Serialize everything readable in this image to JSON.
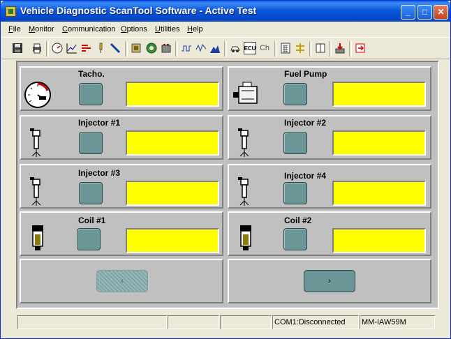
{
  "window": {
    "title": "Vehicle Diagnostic ScanTool Software - Active Test",
    "controls": {
      "minimize": "_",
      "maximize": "□",
      "close": "✕"
    }
  },
  "menu": [
    {
      "label": "File",
      "mnemonic": "F"
    },
    {
      "label": "Monitor",
      "mnemonic": "M"
    },
    {
      "label": "Communication",
      "mnemonic": "C"
    },
    {
      "label": "Options",
      "mnemonic": "O"
    },
    {
      "label": "Utilities",
      "mnemonic": "U"
    },
    {
      "label": "Help",
      "mnemonic": "H"
    }
  ],
  "toolbar": {
    "icons": [
      "save-icon",
      "print-icon",
      "gauge-icon",
      "line-graph-icon",
      "bar-graph-icon",
      "probe-icon",
      "wand-icon",
      "chip-icon",
      "gear-icon",
      "battery-icon",
      "waveform-icon",
      "scope-icon",
      "mountain-graph-icon",
      "car-icon",
      "ecu-icon",
      "channel-icon",
      "calculator-icon",
      "wiring-icon",
      "book-icon",
      "download-icon",
      "exit-icon"
    ],
    "ecu_label": "ECU",
    "ch_label": "Ch"
  },
  "tests": [
    {
      "title": "Tacho.",
      "icon": "tachometer-icon",
      "value": ""
    },
    {
      "title": "Fuel Pump",
      "icon": "fuel-pump-icon",
      "value": ""
    },
    {
      "title": "Injector #1",
      "icon": "injector-icon",
      "value": ""
    },
    {
      "title": "Injector #2",
      "icon": "injector-icon",
      "value": ""
    },
    {
      "title": "Injector #3",
      "icon": "injector-icon",
      "value": ""
    },
    {
      "title": "Injector #4",
      "icon": "injector-icon",
      "value": ""
    },
    {
      "title": "Coil #1",
      "icon": "ignition-coil-icon",
      "value": ""
    },
    {
      "title": "Coil #2",
      "icon": "ignition-coil-icon",
      "value": ""
    }
  ],
  "nav": {
    "prev_label": "‹",
    "next_label": "›"
  },
  "status": {
    "panel1": "",
    "panel2": "",
    "panel3": "",
    "connection": "COM1:Disconnected",
    "ecu_model": "MM-IAW59M"
  },
  "colors": {
    "accent_led": "#6b9698",
    "display": "#ffff00",
    "titlebar": "#0b58dc"
  }
}
